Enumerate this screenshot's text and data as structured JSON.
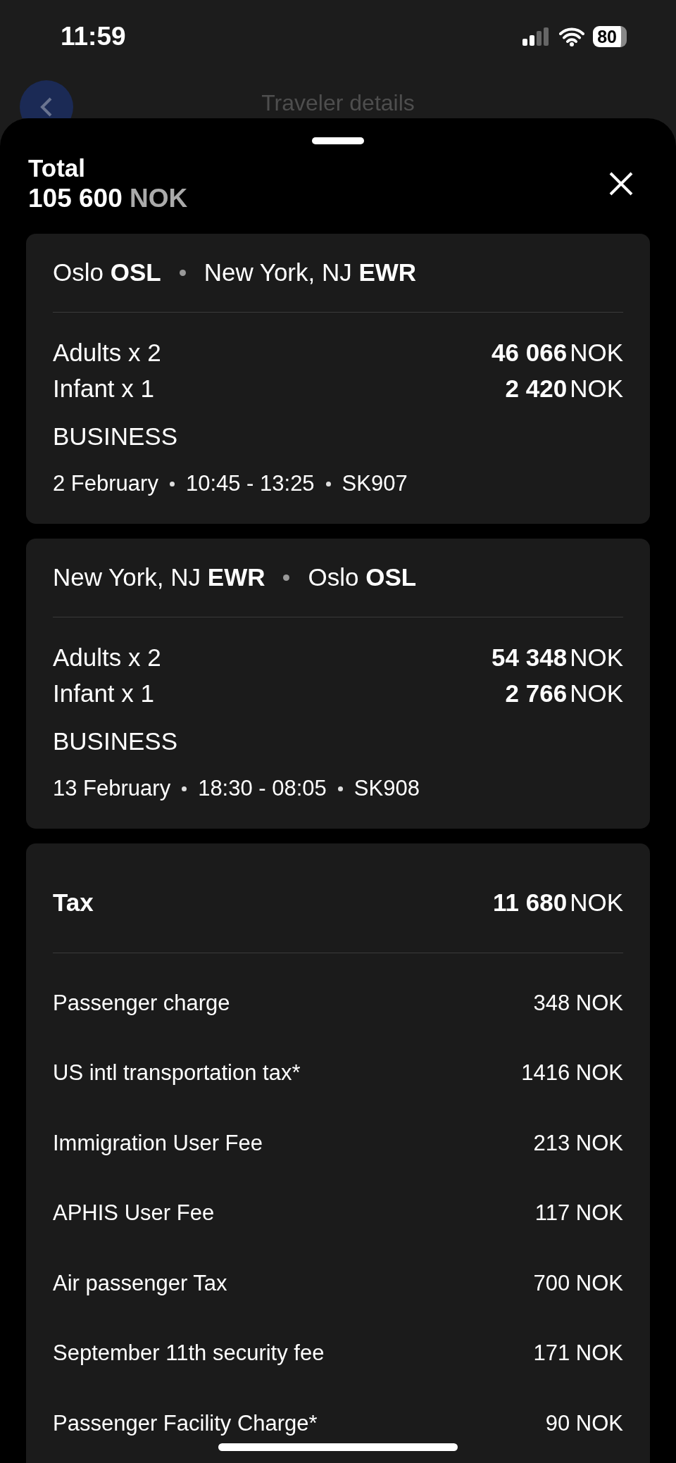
{
  "status_bar": {
    "time": "11:59",
    "battery": "80"
  },
  "background_header": {
    "title": "Traveler details"
  },
  "sheet": {
    "total_label": "Total",
    "total_amount": "105 600",
    "total_currency": "NOK"
  },
  "flights": [
    {
      "origin_city": "Oslo",
      "origin_code": "OSL",
      "dest_city": "New York, NJ",
      "dest_code": "EWR",
      "passengers": [
        {
          "label": "Adults x 2",
          "amount": "46 066",
          "currency": "NOK"
        },
        {
          "label": "Infant x 1",
          "amount": "2 420",
          "currency": "NOK"
        }
      ],
      "cabin": "BUSINESS",
      "details": [
        "2 February",
        "10:45 - 13:25",
        "SK907"
      ]
    },
    {
      "origin_city": "New York, NJ",
      "origin_code": "EWR",
      "dest_city": "Oslo",
      "dest_code": "OSL",
      "passengers": [
        {
          "label": "Adults x 2",
          "amount": "54 348",
          "currency": "NOK"
        },
        {
          "label": "Infant x 1",
          "amount": "2 766",
          "currency": "NOK"
        }
      ],
      "cabin": "BUSINESS",
      "details": [
        "13 February",
        "18:30 - 08:05",
        "SK908"
      ]
    }
  ],
  "tax": {
    "label": "Tax",
    "amount": "11 680",
    "currency": "NOK",
    "items": [
      {
        "label": "Passenger charge",
        "amount": "348 NOK"
      },
      {
        "label": "US intl transportation tax*",
        "amount": "1416 NOK"
      },
      {
        "label": "Immigration User Fee",
        "amount": "213 NOK"
      },
      {
        "label": "APHIS User Fee",
        "amount": "117 NOK"
      },
      {
        "label": "Air passenger Tax",
        "amount": "700 NOK"
      },
      {
        "label": "September 11th security fee",
        "amount": "171 NOK"
      },
      {
        "label": "Passenger Facility Charge*",
        "amount": "90 NOK"
      }
    ]
  }
}
